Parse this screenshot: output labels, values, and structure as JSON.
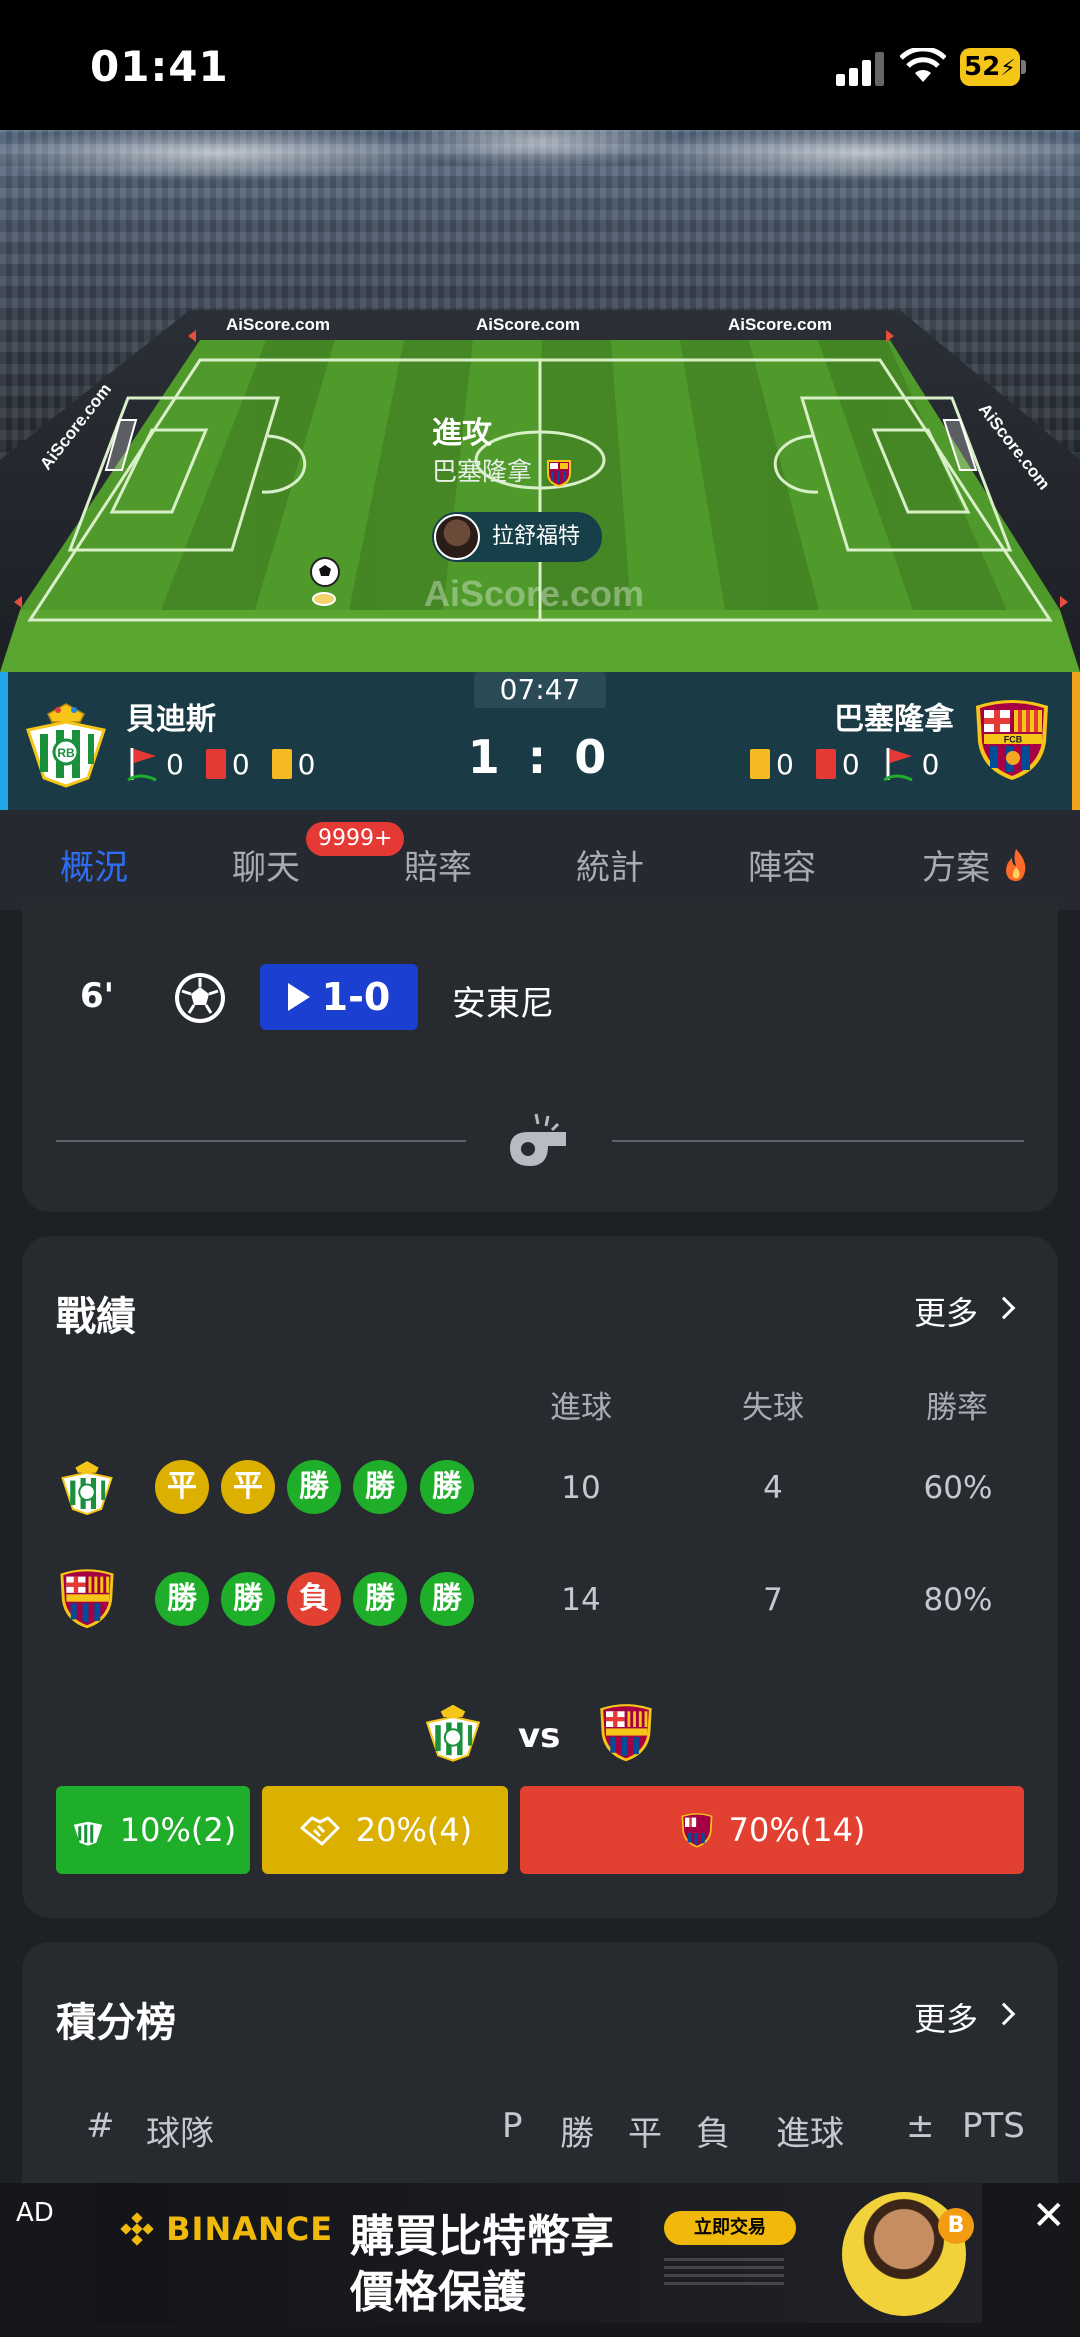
{
  "status_bar": {
    "time": "01:41",
    "battery": "52"
  },
  "pitch": {
    "boards": [
      "AiScore.com",
      "AiScore.com",
      "AiScore.com",
      "AiScore.com",
      "AiScore.com"
    ],
    "watermark": "AiScore.com",
    "attack_label": "進攻",
    "attack_team": "巴塞隆拿",
    "player": "拉舒福特"
  },
  "match": {
    "clock": "07:47",
    "home": {
      "name": "貝迪斯",
      "corners": "0",
      "red_cards": "0",
      "yellow_cards": "0"
    },
    "away": {
      "name": "巴塞隆拿",
      "corners": "0",
      "red_cards": "0",
      "yellow_cards": "0"
    },
    "score": "1 : 0"
  },
  "tabs": [
    {
      "label": "概況",
      "active": true
    },
    {
      "label": "聊天",
      "badge": "9999+"
    },
    {
      "label": "賠率"
    },
    {
      "label": "統計"
    },
    {
      "label": "陣容"
    },
    {
      "label": "方案"
    }
  ],
  "event": {
    "minute": "6'",
    "score": "1-0",
    "player": "安東尼"
  },
  "form": {
    "title": "戰績",
    "more": "更多",
    "columns": [
      "進球",
      "失球",
      "勝率"
    ],
    "home": {
      "results": [
        "平",
        "平",
        "勝",
        "勝",
        "勝"
      ],
      "kinds": [
        "draw",
        "draw",
        "win",
        "win",
        "win"
      ],
      "goals_for": "10",
      "goals_against": "4",
      "win_rate": "60%"
    },
    "away": {
      "results": [
        "勝",
        "勝",
        "負",
        "勝",
        "勝"
      ],
      "kinds": [
        "win",
        "win",
        "loss",
        "win",
        "win"
      ],
      "goals_for": "14",
      "goals_against": "7",
      "win_rate": "80%"
    },
    "vs": "vs",
    "h2h": {
      "home": "10%(2)",
      "draw": "20%(4)",
      "away": "70%(14)"
    },
    "colors": {
      "home": "#1fae2a",
      "draw": "#dcb000",
      "away": "#e24030"
    }
  },
  "standings": {
    "title": "積分榜",
    "more": "更多",
    "headers": [
      "#",
      "球隊",
      "P",
      "勝",
      "平",
      "負",
      "進球",
      "±",
      "PTS"
    ]
  },
  "ad": {
    "label": "AD",
    "brand": "BINANCE",
    "headline1": "購買比特幣享",
    "headline2": "價格保護",
    "cta": "立即交易",
    "close": "✕",
    "coin": "B"
  }
}
